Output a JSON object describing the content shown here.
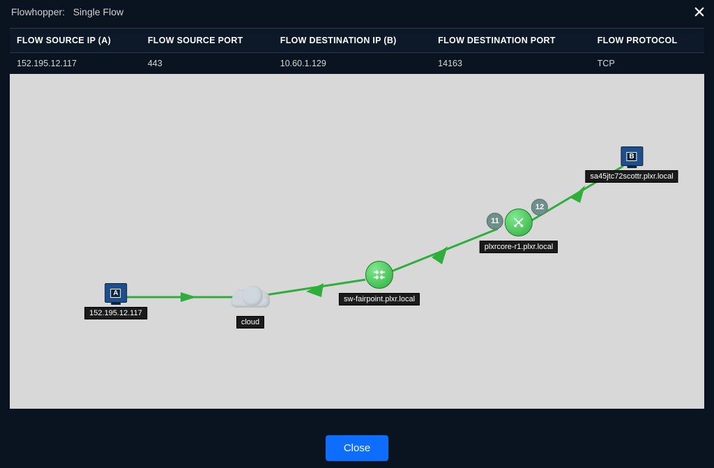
{
  "dialog": {
    "title_prefix": "Flowhopper:",
    "title_suffix": "Single Flow"
  },
  "table": {
    "headers": {
      "src_ip": "FLOW SOURCE IP (A)",
      "src_port": "FLOW SOURCE PORT",
      "dst_ip": "FLOW DESTINATION IP (B)",
      "dst_port": "FLOW DESTINATION PORT",
      "protocol": "FLOW PROTOCOL"
    },
    "row": {
      "src_ip": "152.195.12.117",
      "src_port": "443",
      "dst_ip": "10.60.1.129",
      "dst_port": "14163",
      "protocol": "TCP"
    }
  },
  "topology": {
    "nodes": {
      "host_a": {
        "letter": "A",
        "label": "152.195.12.117"
      },
      "cloud": {
        "label": "cloud"
      },
      "sw": {
        "label": "sw-fairpoint.plxr.local"
      },
      "core": {
        "label": "plxrcore-r1.plxr.local",
        "hop_left": "11",
        "hop_right": "12"
      },
      "host_b": {
        "letter": "B",
        "label": "sa45jtc72scottr.plxr.local"
      }
    }
  },
  "buttons": {
    "close": "Close"
  },
  "colors": {
    "link": "#2fae3c",
    "primary": "#0d6efd"
  }
}
